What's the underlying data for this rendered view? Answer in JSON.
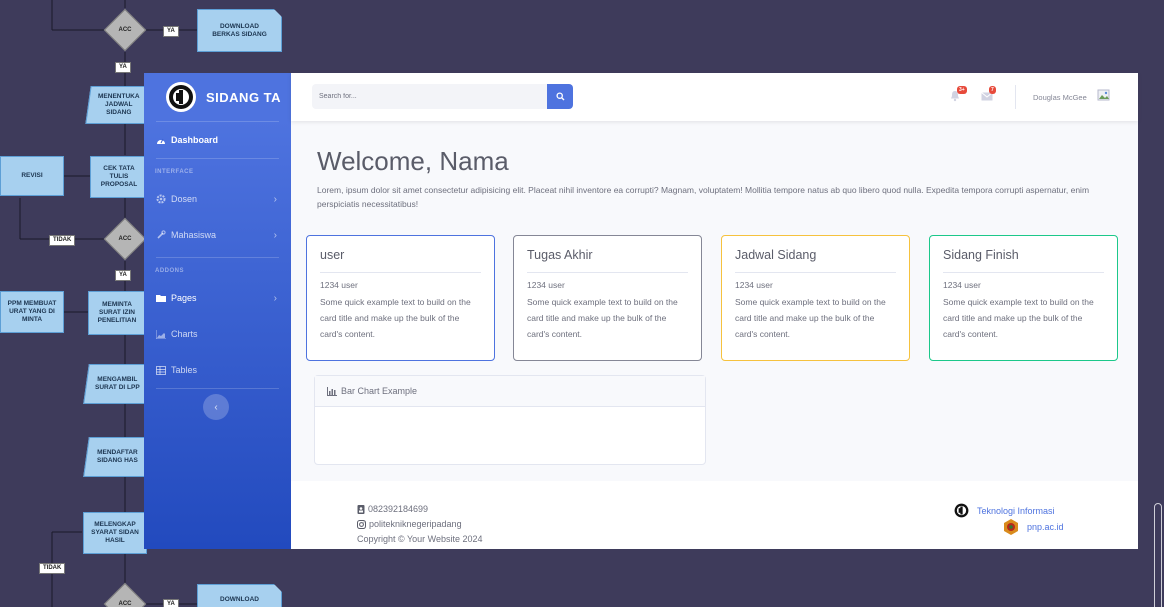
{
  "flowchart": {
    "download_top": "DOWNLOAD\nBERKAS SIDANG",
    "acc_top": "ACC",
    "ya_top": "YA",
    "ya_2": "YA",
    "menentukan": "MENENTUKA\nJADWAL\nSIDANG",
    "revisi": "REVISI",
    "cek_tata": "CEK TATA\nTULIS\nPROPOSAL",
    "tidak_1": "TIDAK",
    "acc_mid": "ACC",
    "ya_3": "YA",
    "lppm": "PPM MEMBUAT\nURAT YANG DI\nMINTA",
    "meminta": "MEMINTA\nSURAT IZIN\nPENELITIAN",
    "mengambil": "MENGAMBIL\nSURAT DI LPP",
    "mendaftar": "MENDAFTAR\nSIDANG HAS",
    "melengkapi": "MELENGKAP\nSYARAT SIDAN\nHASIL",
    "tidak_2": "TIDAK",
    "acc_bottom": "ACC",
    "ya_bottom": "YA",
    "download_bottom": "DOWNLOAD"
  },
  "sidebar": {
    "brand": "SIDANG TA",
    "dashboard": "Dashboard",
    "heading_interface": "INTERFACE",
    "dosen": "Dosen",
    "mahasiswa": "Mahasiswa",
    "heading_addons": "ADDONS",
    "pages": "Pages",
    "charts": "Charts",
    "tables": "Tables"
  },
  "topbar": {
    "search_placeholder": "Search for...",
    "alerts_badge": "3+",
    "messages_badge": "7",
    "user_name": "Douglas McGee"
  },
  "main": {
    "welcome": "Welcome, Nama",
    "lead": "Lorem, ipsum dolor sit amet consectetur adipisicing elit. Placeat nihil inventore ea corrupti? Magnam, voluptatem! Mollitia tempore natus ab quo libero quod nulla. Expedita tempora corrupti aspernatur, enim perspiciatis necessitatibus!",
    "cards": [
      {
        "title": "user",
        "subtitle": "1234 user",
        "text": "Some quick example text to build on the card title and make up the bulk of the card's content.",
        "border": "#4e73df"
      },
      {
        "title": "Tugas Akhir",
        "subtitle": "1234 user",
        "text": "Some quick example text to build on the card title and make up the bulk of the card's content.",
        "border": "#858796"
      },
      {
        "title": "Jadwal Sidang",
        "subtitle": "1234 user",
        "text": "Some quick example text to build on the card title and make up the bulk of the card's content.",
        "border": "#f6c23e"
      },
      {
        "title": "Sidang Finish",
        "subtitle": "1234 user",
        "text": "Some quick example text to build on the card title and make up the bulk of the card's content.",
        "border": "#1cc88a"
      }
    ],
    "chart_title": "Bar Chart Example"
  },
  "footer": {
    "phone": "082392184699",
    "instagram": "politekniknegeripadang",
    "copyright": "Copyright © Your Website 2024",
    "link_ti": "Teknologi Informasi",
    "link_pnp": "pnp.ac.id"
  },
  "colors": {
    "primary": "#4e73df",
    "danger": "#e74a3b",
    "background": "#3e3b5b"
  }
}
